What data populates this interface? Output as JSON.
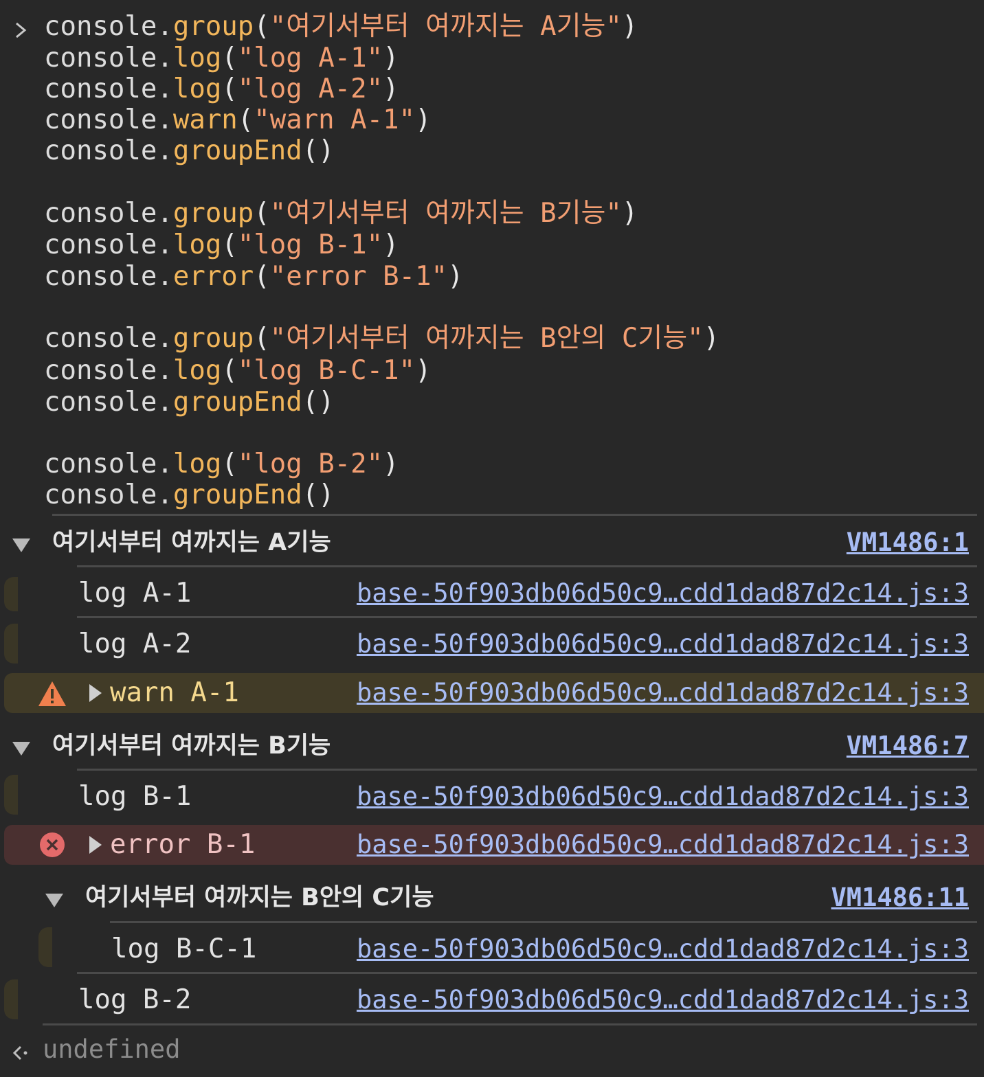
{
  "input": {
    "lines": [
      [
        {
          "t": "console",
          "k": "plain"
        },
        {
          "t": ".",
          "k": "plain"
        },
        {
          "t": "group",
          "k": "fn"
        },
        {
          "t": "(",
          "k": "punct"
        },
        {
          "t": "\"여기서부터 여까지는 A기능\"",
          "k": "str"
        },
        {
          "t": ")",
          "k": "punct"
        }
      ],
      [
        {
          "t": "console",
          "k": "plain"
        },
        {
          "t": ".",
          "k": "plain"
        },
        {
          "t": "log",
          "k": "fn"
        },
        {
          "t": "(",
          "k": "punct"
        },
        {
          "t": "\"log A-1\"",
          "k": "str"
        },
        {
          "t": ")",
          "k": "punct"
        }
      ],
      [
        {
          "t": "console",
          "k": "plain"
        },
        {
          "t": ".",
          "k": "plain"
        },
        {
          "t": "log",
          "k": "fn"
        },
        {
          "t": "(",
          "k": "punct"
        },
        {
          "t": "\"log A-2\"",
          "k": "str"
        },
        {
          "t": ")",
          "k": "punct"
        }
      ],
      [
        {
          "t": "console",
          "k": "plain"
        },
        {
          "t": ".",
          "k": "plain"
        },
        {
          "t": "warn",
          "k": "fn"
        },
        {
          "t": "(",
          "k": "punct"
        },
        {
          "t": "\"warn A-1\"",
          "k": "str"
        },
        {
          "t": ")",
          "k": "punct"
        }
      ],
      [
        {
          "t": "console",
          "k": "plain"
        },
        {
          "t": ".",
          "k": "plain"
        },
        {
          "t": "groupEnd",
          "k": "fn"
        },
        {
          "t": "()",
          "k": "punct"
        }
      ],
      [],
      [
        {
          "t": "console",
          "k": "plain"
        },
        {
          "t": ".",
          "k": "plain"
        },
        {
          "t": "group",
          "k": "fn"
        },
        {
          "t": "(",
          "k": "punct"
        },
        {
          "t": "\"여기서부터 여까지는 B기능\"",
          "k": "str"
        },
        {
          "t": ")",
          "k": "punct"
        }
      ],
      [
        {
          "t": "console",
          "k": "plain"
        },
        {
          "t": ".",
          "k": "plain"
        },
        {
          "t": "log",
          "k": "fn"
        },
        {
          "t": "(",
          "k": "punct"
        },
        {
          "t": "\"log B-1\"",
          "k": "str"
        },
        {
          "t": ")",
          "k": "punct"
        }
      ],
      [
        {
          "t": "console",
          "k": "plain"
        },
        {
          "t": ".",
          "k": "plain"
        },
        {
          "t": "error",
          "k": "fn"
        },
        {
          "t": "(",
          "k": "punct"
        },
        {
          "t": "\"error B-1\"",
          "k": "str"
        },
        {
          "t": ")",
          "k": "punct"
        }
      ],
      [],
      [
        {
          "t": "console",
          "k": "plain"
        },
        {
          "t": ".",
          "k": "plain"
        },
        {
          "t": "group",
          "k": "fn"
        },
        {
          "t": "(",
          "k": "punct"
        },
        {
          "t": "\"여기서부터 여까지는 B안의 C기능\"",
          "k": "str"
        },
        {
          "t": ")",
          "k": "punct"
        }
      ],
      [
        {
          "t": "console",
          "k": "plain"
        },
        {
          "t": ".",
          "k": "plain"
        },
        {
          "t": "log",
          "k": "fn"
        },
        {
          "t": "(",
          "k": "punct"
        },
        {
          "t": "\"log B-C-1\"",
          "k": "str"
        },
        {
          "t": ")",
          "k": "punct"
        }
      ],
      [
        {
          "t": "console",
          "k": "plain"
        },
        {
          "t": ".",
          "k": "plain"
        },
        {
          "t": "groupEnd",
          "k": "fn"
        },
        {
          "t": "()",
          "k": "punct"
        }
      ],
      [],
      [
        {
          "t": "console",
          "k": "plain"
        },
        {
          "t": ".",
          "k": "plain"
        },
        {
          "t": "log",
          "k": "fn"
        },
        {
          "t": "(",
          "k": "punct"
        },
        {
          "t": "\"log B-2\"",
          "k": "str"
        },
        {
          "t": ")",
          "k": "punct"
        }
      ],
      [
        {
          "t": "console",
          "k": "plain"
        },
        {
          "t": ".",
          "k": "plain"
        },
        {
          "t": "groupEnd",
          "k": "fn"
        },
        {
          "t": "()",
          "k": "punct"
        }
      ]
    ]
  },
  "output": {
    "group_a": {
      "title": "여기서부터 여까지는 A기능",
      "source": "VM1486:1"
    },
    "log_a1": {
      "text": "log A-1",
      "source": "base-50f903db06d50c9…cdd1dad87d2c14.js:3"
    },
    "log_a2": {
      "text": "log A-2",
      "source": "base-50f903db06d50c9…cdd1dad87d2c14.js:3"
    },
    "warn_a1": {
      "text": "warn A-1",
      "source": "base-50f903db06d50c9…cdd1dad87d2c14.js:3"
    },
    "group_b": {
      "title": "여기서부터 여까지는 B기능",
      "source": "VM1486:7"
    },
    "log_b1": {
      "text": "log B-1",
      "source": "base-50f903db06d50c9…cdd1dad87d2c14.js:3"
    },
    "error_b1": {
      "text": "error B-1",
      "source": "base-50f903db06d50c9…cdd1dad87d2c14.js:3"
    },
    "group_c": {
      "title": "여기서부터 여까지는 B안의 C기능",
      "source": "VM1486:11"
    },
    "log_bc1": {
      "text": "log B-C-1",
      "source": "base-50f903db06d50c9…cdd1dad87d2c14.js:3"
    },
    "log_b2": {
      "text": "log B-2",
      "source": "base-50f903db06d50c9…cdd1dad87d2c14.js:3"
    },
    "result": "undefined"
  },
  "colors": {
    "background": "#282828",
    "function_name": "#f2b65b",
    "string": "#f29e72",
    "link": "#a7bcf4",
    "warn_background": "#413b27",
    "error_background": "#4a3030",
    "warn_icon": "#f0804e",
    "error_icon": "#e46a6a"
  },
  "icons": {
    "prompt": "chevron-right-icon",
    "result": "result-arrow-icon",
    "warn": "warning-triangle-icon",
    "error": "error-circle-icon",
    "group_collapse": "caret-down-icon",
    "expand": "caret-right-icon"
  }
}
